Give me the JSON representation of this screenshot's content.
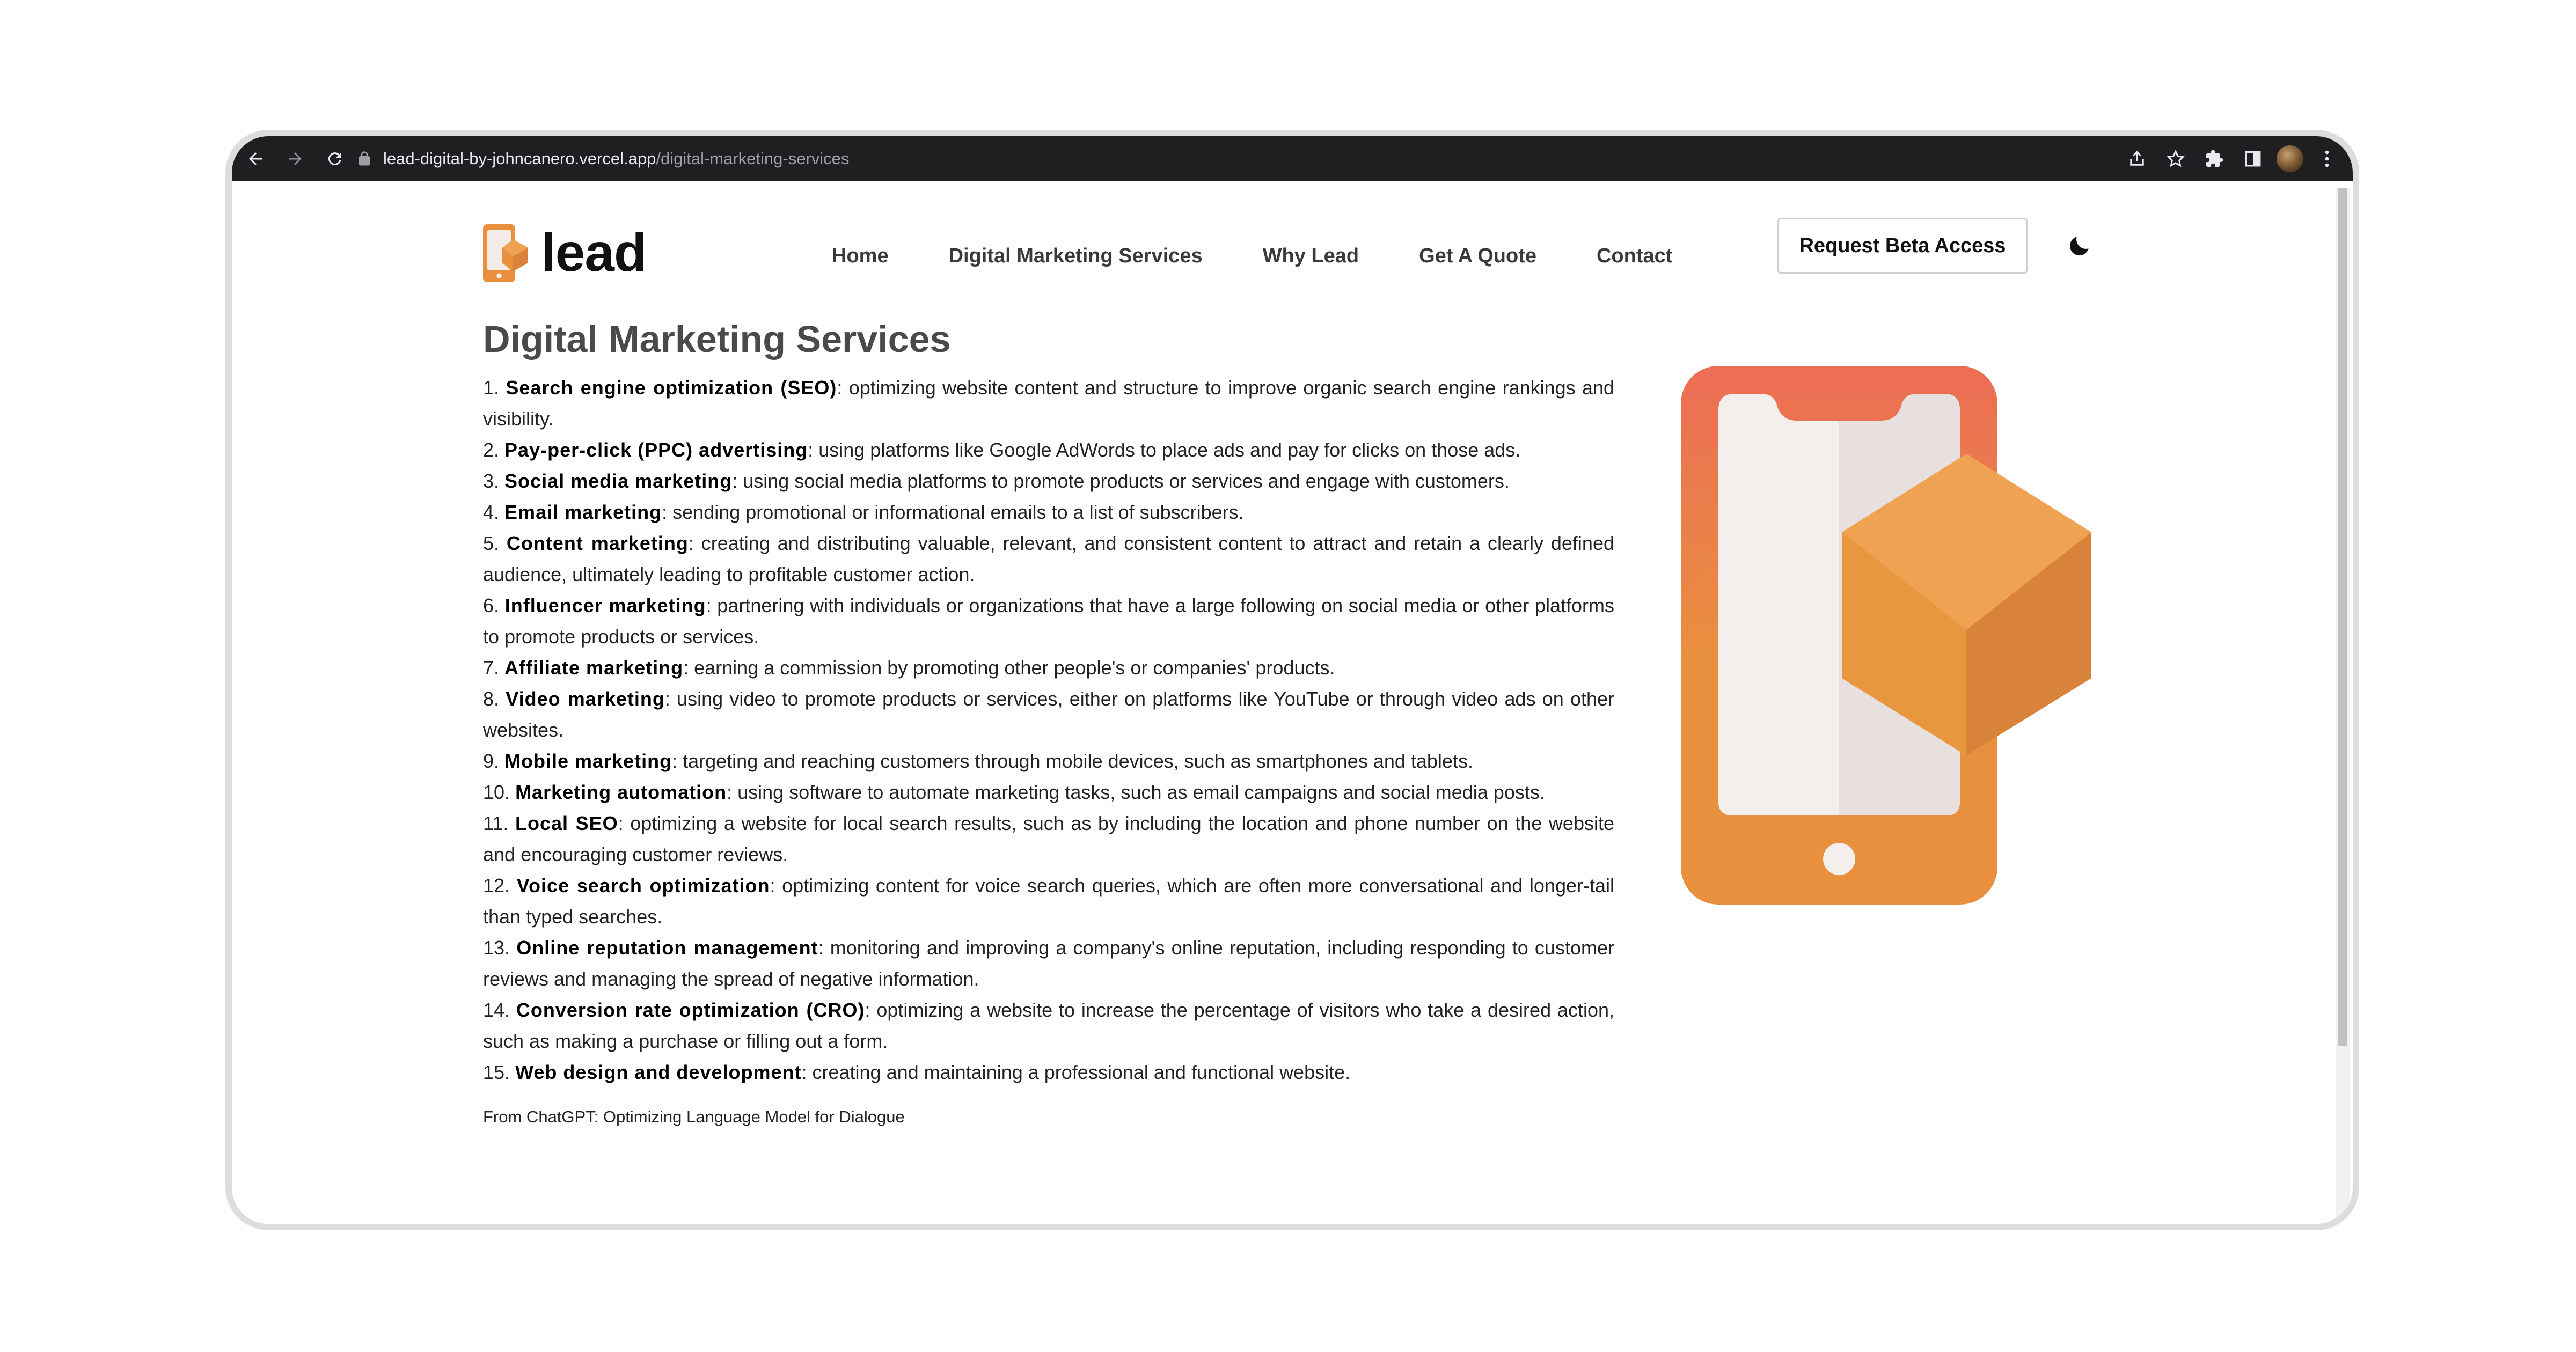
{
  "browser": {
    "url_host": "lead-digital-by-johncanero.vercel.app",
    "url_path": "/digital-marketing-services"
  },
  "header": {
    "logo_text": "lead",
    "menu": [
      "Home",
      "Digital Marketing Services",
      "Why Lead",
      "Get A Quote",
      "Contact"
    ],
    "beta_button": "Request Beta Access"
  },
  "main": {
    "title": "Digital Marketing Services",
    "services": [
      {
        "num": "1.",
        "name": "Search engine optimization (SEO)",
        "desc": ": optimizing website content and structure to improve organic search engine rankings and visibility."
      },
      {
        "num": "2.",
        "name": "Pay-per-click (PPC) advertising",
        "desc": ": using platforms like Google AdWords to place ads and pay for clicks on those ads."
      },
      {
        "num": "3.",
        "name": "Social media marketing",
        "desc": ": using social media platforms to promote products or services and engage with customers."
      },
      {
        "num": "4.",
        "name": "Email marketing",
        "desc": ": sending promotional or informational emails to a list of subscribers."
      },
      {
        "num": "5.",
        "name": "Content marketing",
        "desc": ": creating and distributing valuable, relevant, and consistent content to attract and retain a clearly defined audience, ultimately leading to profitable customer action."
      },
      {
        "num": "6.",
        "name": "Influencer marketing",
        "desc": ": partnering with individuals or organizations that have a large following on social media or other platforms to promote products or services."
      },
      {
        "num": "7.",
        "name": "Affiliate marketing",
        "desc": ": earning a commission by promoting other people's or companies' products."
      },
      {
        "num": "8.",
        "name": "Video marketing",
        "desc": ": using video to promote products or services, either on platforms like YouTube or through video ads on other websites."
      },
      {
        "num": "9.",
        "name": "Mobile marketing",
        "desc": ": targeting and reaching customers through mobile devices, such as smartphones and tablets."
      },
      {
        "num": "10.",
        "name": "Marketing automation",
        "desc": ": using software to automate marketing tasks, such as email campaigns and social media posts."
      },
      {
        "num": "11.",
        "name": "Local SEO",
        "desc": ": optimizing a website for local search results, such as by including the location and phone number on the website and encouraging customer reviews."
      },
      {
        "num": "12.",
        "name": "Voice search optimization",
        "desc": ": optimizing content for voice search queries, which are often more conversational and longer-tail than typed searches."
      },
      {
        "num": "13.",
        "name": "Online reputation management",
        "desc": ": monitoring and improving a company's online reputation, including responding to customer reviews and managing the spread of negative information."
      },
      {
        "num": "14.",
        "name": "Conversion rate optimization (CRO)",
        "desc": ": optimizing a website to increase the percentage of visitors who take a desired action, such as making a purchase or filling out a form."
      },
      {
        "num": "15.",
        "name": "Web design and development",
        "desc": ": creating and maintaining a professional and functional website."
      }
    ],
    "credit": "From ChatGPT: Optimizing Language Model for Dialogue"
  },
  "colors": {
    "brand_orange": "#e9903f",
    "brand_red": "#ec6d55",
    "cube_light": "#efa352",
    "cube_dark": "#d9823a"
  },
  "icons": [
    "back-icon",
    "forward-icon",
    "reload-icon",
    "lock-icon",
    "share-icon",
    "star-icon",
    "extensions-icon",
    "sidepanel-icon",
    "kebab-menu-icon",
    "moon-icon"
  ]
}
